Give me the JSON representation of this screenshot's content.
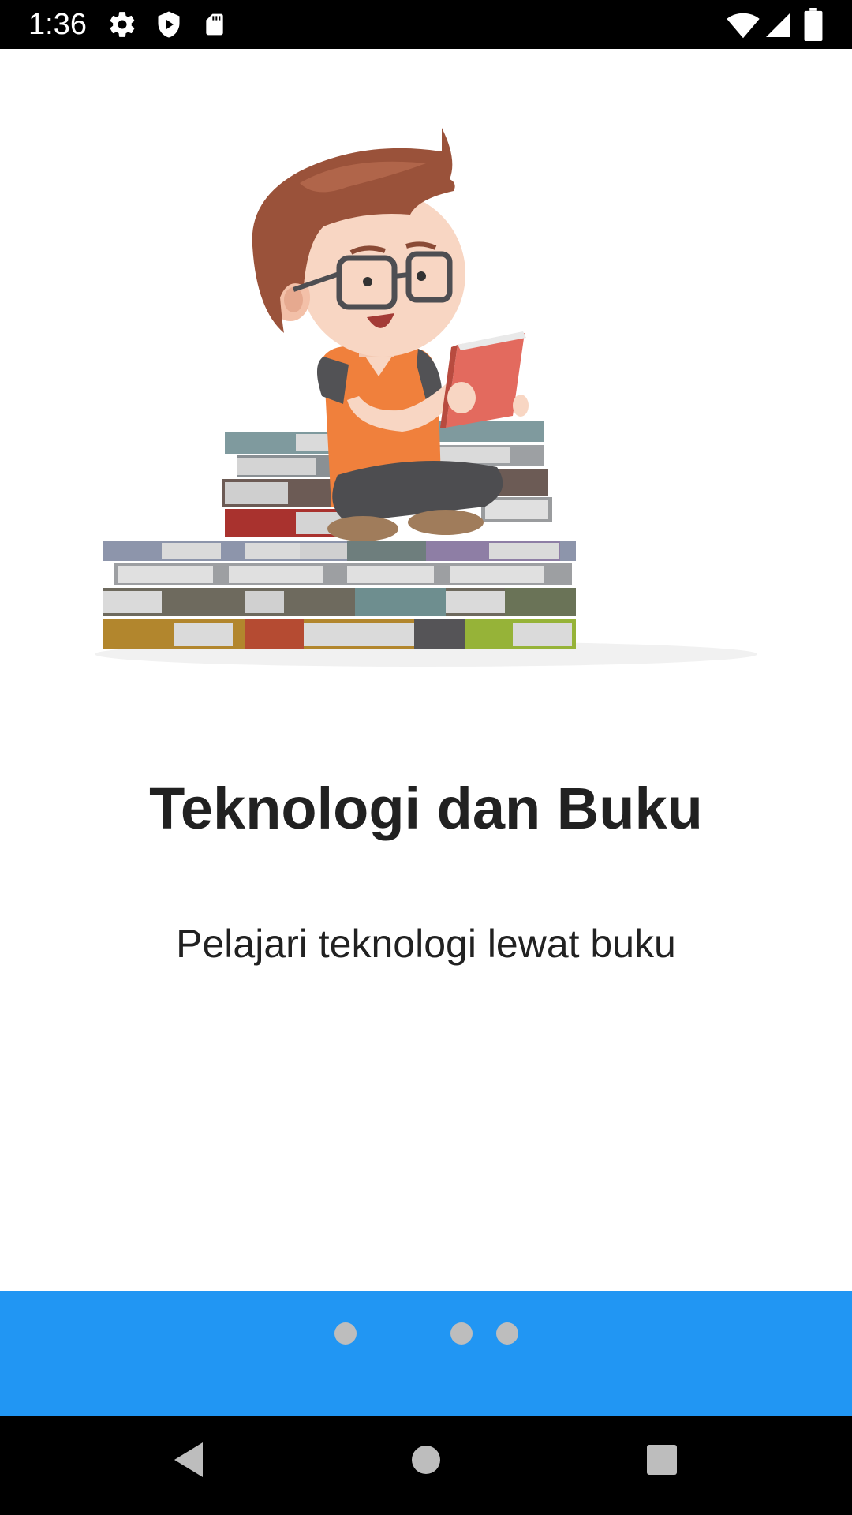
{
  "status_bar": {
    "time": "1:36",
    "icons": [
      "gear-icon",
      "shield-play-icon",
      "sd-card-icon",
      "wifi-icon",
      "signal-icon",
      "battery-icon"
    ]
  },
  "onboarding": {
    "illustration": "boy-reading-on-book-stack",
    "title": "Teknologi dan Buku",
    "subtitle": "Pelajari teknologi lewat buku"
  },
  "pager": {
    "dots": 3,
    "active_index": 1,
    "accent_color": "#2196F3",
    "dot_color": "#BDBDBD"
  },
  "navigation": {
    "buttons": [
      "back-icon",
      "home-icon",
      "recents-icon"
    ]
  }
}
